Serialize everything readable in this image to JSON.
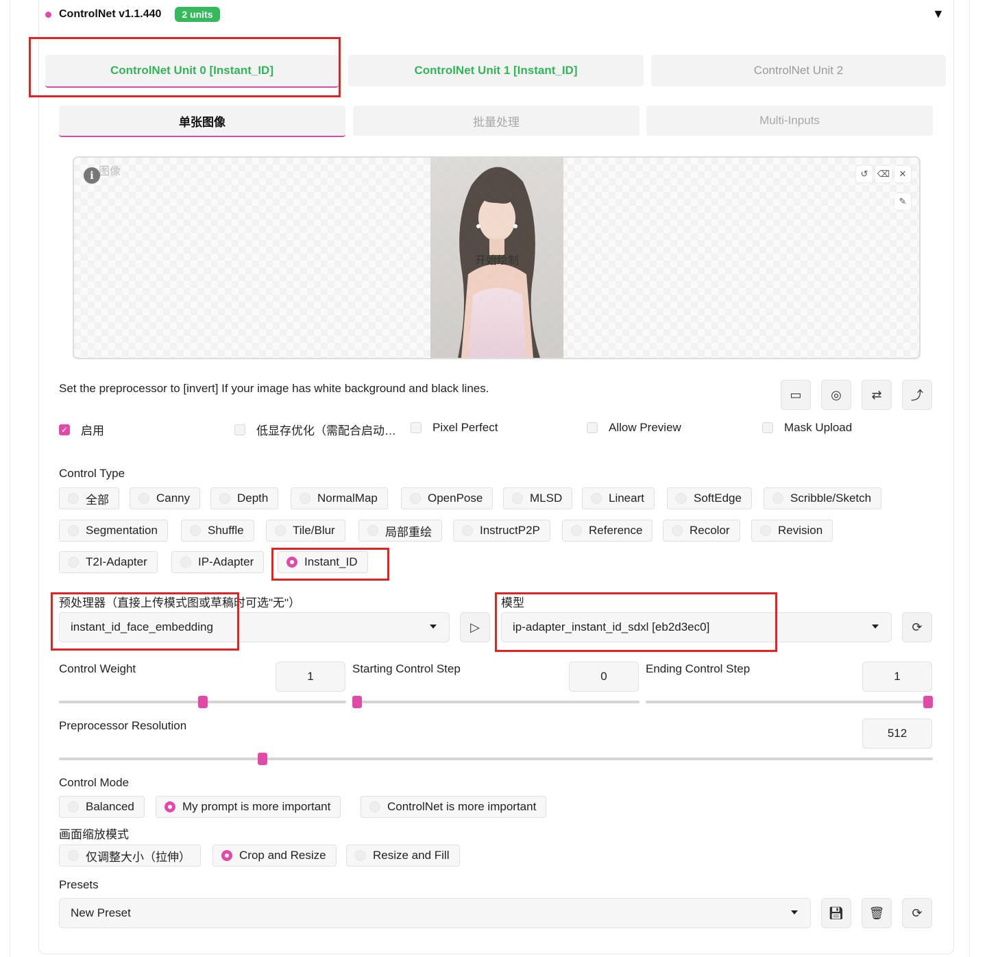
{
  "header": {
    "title": "ControlNet v1.1.440",
    "badge": "2 units"
  },
  "unit_tabs": [
    "ControlNet Unit 0 [Instant_ID]",
    "ControlNet Unit 1 [Instant_ID]",
    "ControlNet Unit 2"
  ],
  "sub_tabs": [
    "单张图像",
    "批量处理",
    "Multi-Inputs"
  ],
  "image_panel": {
    "label": "图像",
    "draw_label": "开始绘制"
  },
  "hint": "Set the preprocessor to [invert] If your image has white background and black lines.",
  "checkboxes": [
    {
      "label": "启用",
      "checked": true
    },
    {
      "label": "低显存优化（需配合启动…",
      "checked": false
    },
    {
      "label": "Pixel Perfect",
      "checked": false
    },
    {
      "label": "Allow Preview",
      "checked": false
    },
    {
      "label": "Mask Upload",
      "checked": false
    }
  ],
  "control_type": {
    "label": "Control Type",
    "options": [
      "全部",
      "Canny",
      "Depth",
      "NormalMap",
      "OpenPose",
      "MLSD",
      "Lineart",
      "SoftEdge",
      "Scribble/Sketch",
      "Segmentation",
      "Shuffle",
      "Tile/Blur",
      "局部重绘",
      "InstructP2P",
      "Reference",
      "Recolor",
      "Revision",
      "T2I-Adapter",
      "IP-Adapter",
      "Instant_ID"
    ],
    "selected": "Instant_ID"
  },
  "preprocessor": {
    "label": "预处理器（直接上传模式图或草稿时可选\"无\"）",
    "value": "instant_id_face_embedding"
  },
  "model": {
    "label": "模型",
    "value": "ip-adapter_instant_id_sdxl [eb2d3ec0]"
  },
  "sliders": {
    "control_weight": {
      "label": "Control Weight",
      "value": "1",
      "fraction": 0.5
    },
    "starting_step": {
      "label": "Starting Control Step",
      "value": "0",
      "fraction": 0.0
    },
    "ending_step": {
      "label": "Ending Control Step",
      "value": "1",
      "fraction": 1.0
    },
    "preprocessor_resolution": {
      "label": "Preprocessor Resolution",
      "value": "512",
      "fraction": 0.23
    }
  },
  "control_mode": {
    "label": "Control Mode",
    "options": [
      "Balanced",
      "My prompt is more important",
      "ControlNet is more important"
    ],
    "selected": "My prompt is more important"
  },
  "resize_mode": {
    "label": "画面缩放模式",
    "options": [
      "仅调整大小（拉伸）",
      "Crop and Resize",
      "Resize and Fill"
    ],
    "selected": "Crop and Resize"
  },
  "presets": {
    "label": "Presets",
    "value": "New Preset"
  },
  "colors": {
    "accent": "#e04ba9",
    "green": "#36b85c",
    "highlight": "#e32323"
  },
  "icons": [
    "info-icon",
    "undo-icon",
    "eraser-icon",
    "close-icon",
    "brush-icon",
    "camera-icon",
    "webcam-icon",
    "swap-icon",
    "upload-icon",
    "play-icon",
    "refresh-icon",
    "save-icon",
    "trash-icon",
    "chevron-down-icon"
  ]
}
